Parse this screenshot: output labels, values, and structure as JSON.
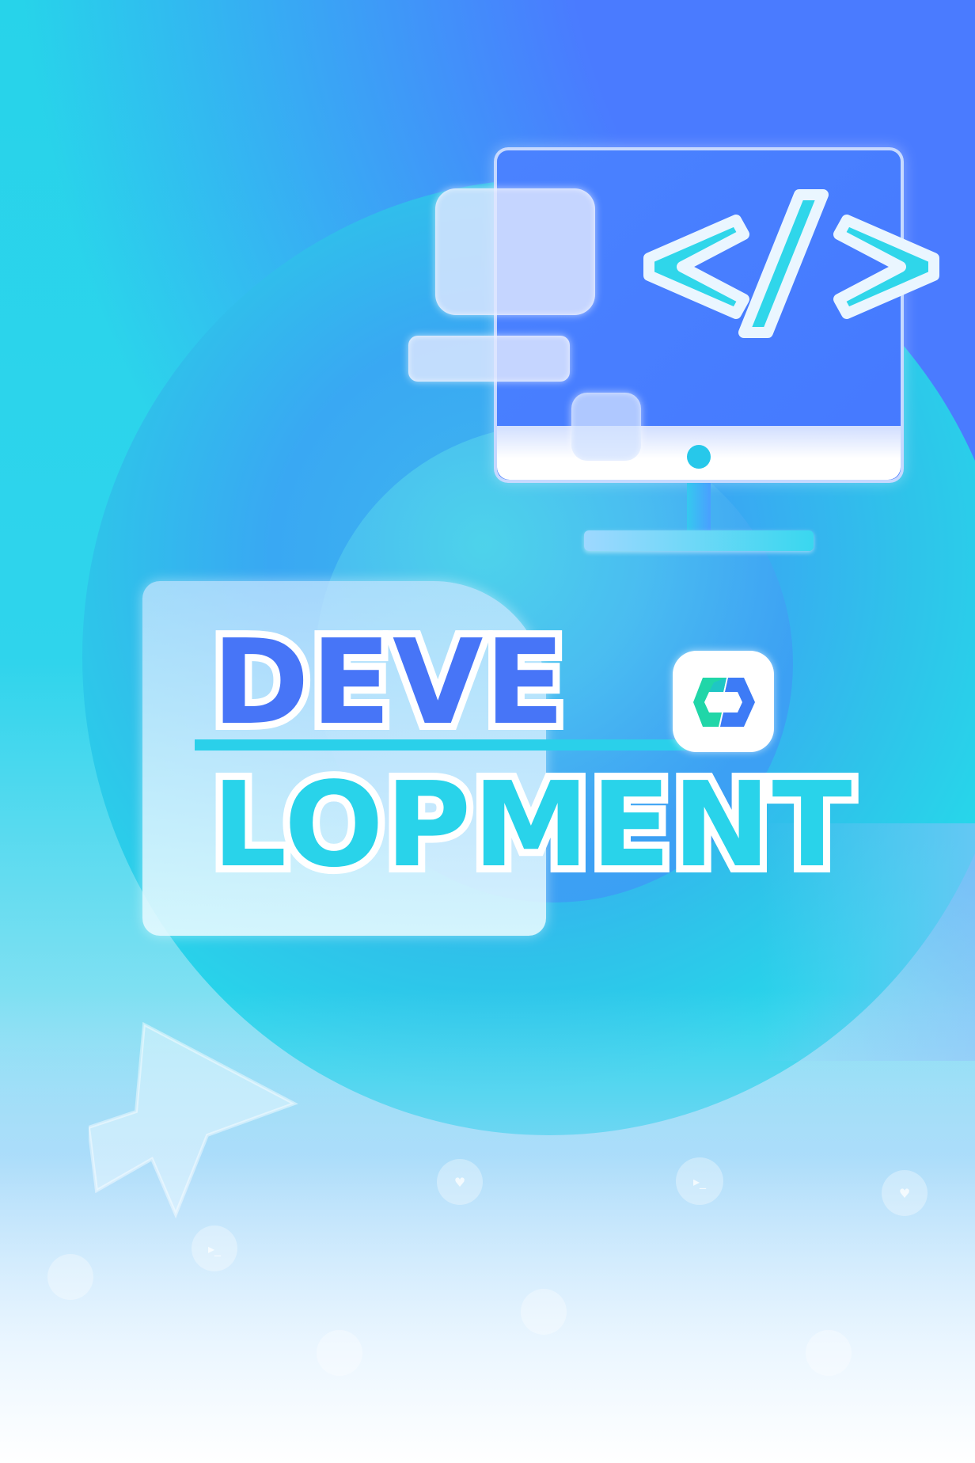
{
  "title": {
    "line1": "DEVE",
    "line2": "LOPMENT"
  },
  "colors": {
    "accent_blue": "#4775f7",
    "accent_cyan": "#29d3ea",
    "monitor_blue": "#4a82ff",
    "logo_green": "#20d6a8"
  },
  "icons": [
    "code-brackets-icon",
    "monitor-icon",
    "logo-icon",
    "cursor-arrow-icon",
    "terminal-icon",
    "heart-icon"
  ]
}
